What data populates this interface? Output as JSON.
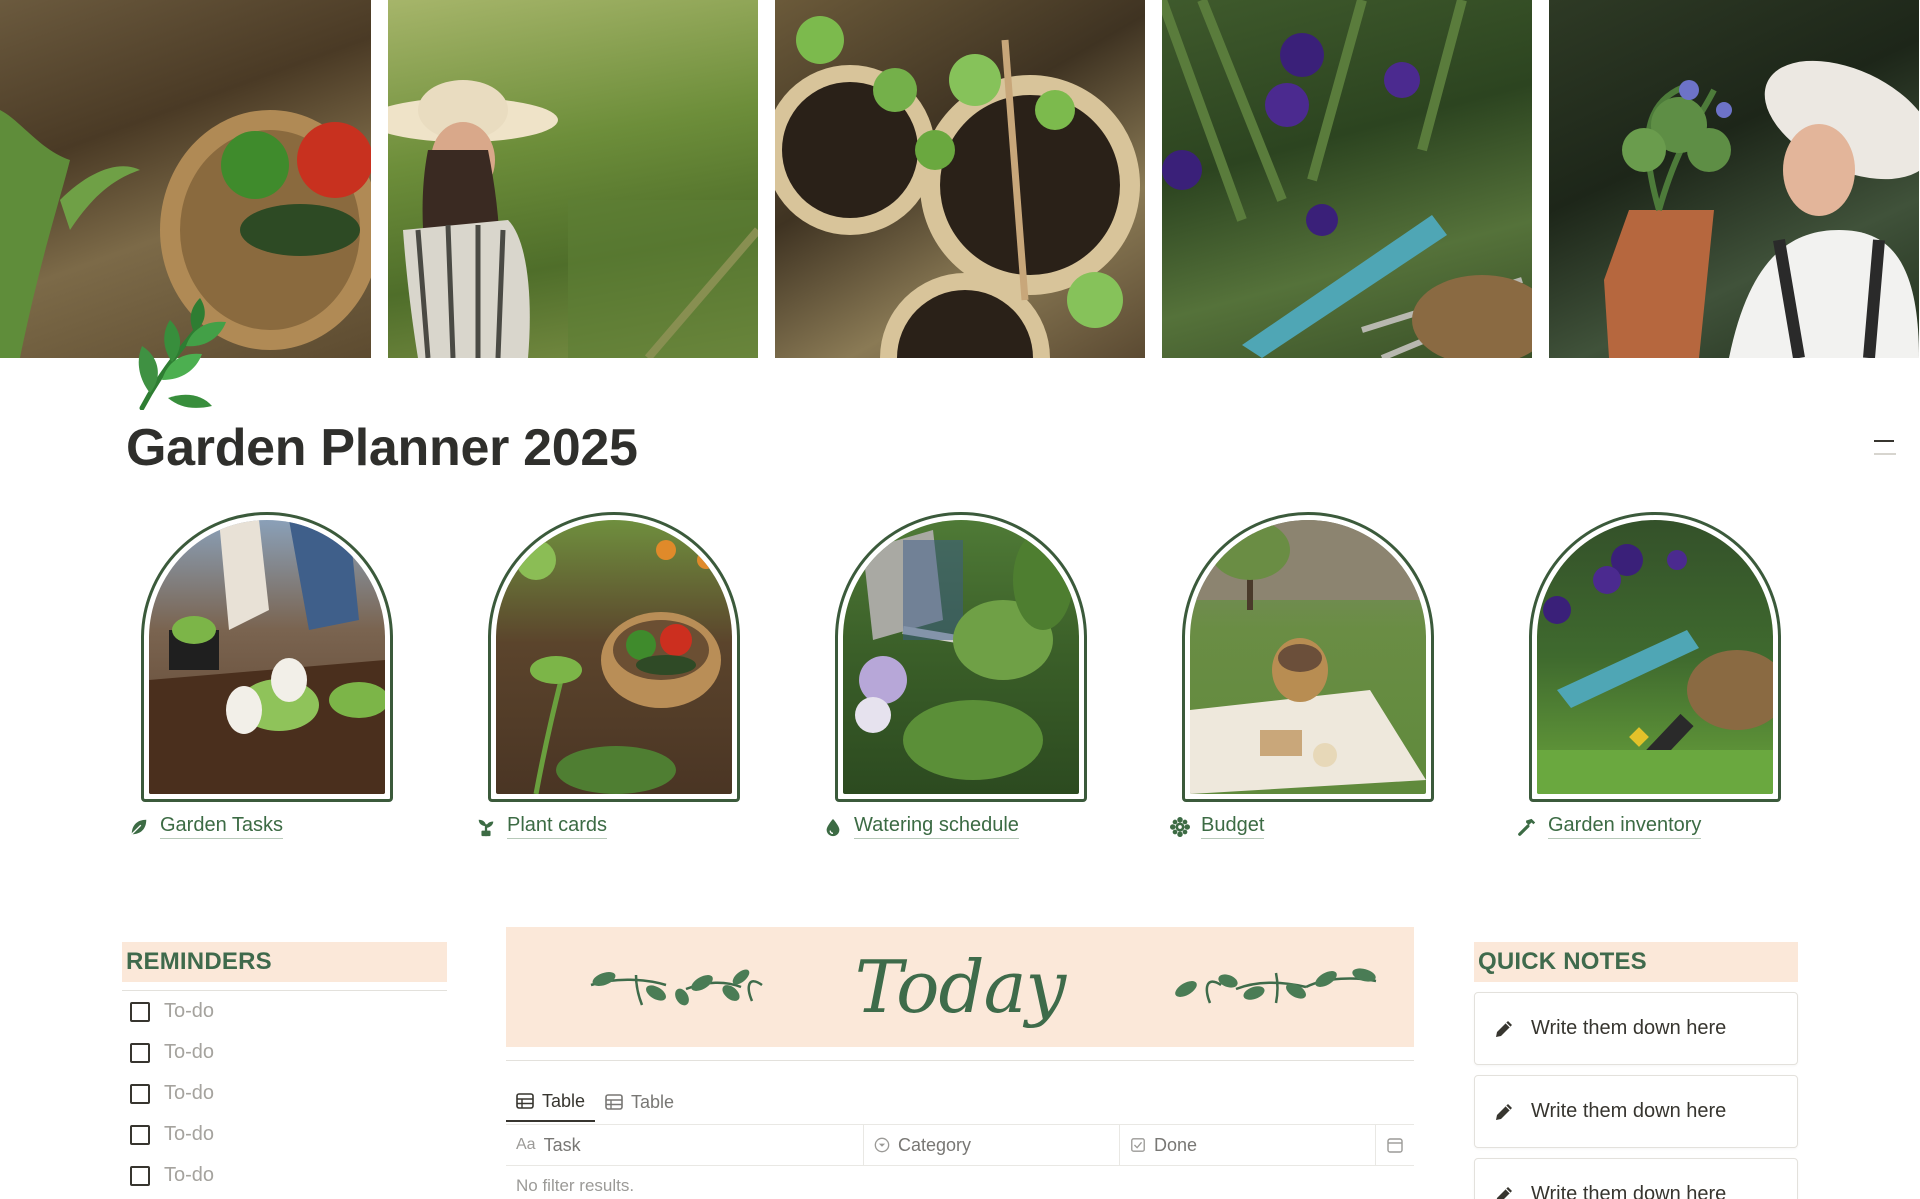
{
  "cover": {
    "photos": [
      "garden-basket-photo",
      "woman-in-garden-photo",
      "seedling-pots-photo",
      "pansies-trowel-photo",
      "woman-holding-plant-photo"
    ]
  },
  "page": {
    "icon": "leaf-sprig-icon",
    "title": "Garden Planner 2025"
  },
  "gallery": [
    {
      "label": "Garden Tasks",
      "icon": "leaf-icon",
      "image": "planting-seedlings-photo"
    },
    {
      "label": "Plant cards",
      "icon": "sprout-icon",
      "image": "vegetable-basket-photo"
    },
    {
      "label": "Watering schedule",
      "icon": "water-drop-icon",
      "image": "watering-can-photo"
    },
    {
      "label": "Budget",
      "icon": "gear-flower-icon",
      "image": "picnic-lawn-photo"
    },
    {
      "label": "Garden inventory",
      "icon": "hammer-icon",
      "image": "trowel-pansies-photo"
    }
  ],
  "reminders": {
    "heading": "REMINDERS",
    "items": [
      {
        "label": "To-do",
        "checked": false
      },
      {
        "label": "To-do",
        "checked": false
      },
      {
        "label": "To-do",
        "checked": false
      },
      {
        "label": "To-do",
        "checked": false
      },
      {
        "label": "To-do",
        "checked": false
      }
    ]
  },
  "today": {
    "banner_text": "Today",
    "tabs": [
      {
        "label": "Table",
        "active": true
      },
      {
        "label": "Table",
        "active": false
      }
    ],
    "columns": [
      {
        "label": "Task",
        "type_icon": "Aa"
      },
      {
        "label": "Category",
        "type_icon": "select-icon"
      },
      {
        "label": "Done",
        "type_icon": "checkbox-icon"
      }
    ],
    "empty_text": "No filter results."
  },
  "quick_notes": {
    "heading": "QUICK NOTES",
    "items": [
      {
        "label": "Write them down here"
      },
      {
        "label": "Write them down here"
      },
      {
        "label": "Write them down here"
      }
    ]
  },
  "colors": {
    "accent_green": "#3c6b44",
    "banner_peach": "#fbe8d9",
    "arch_border": "#3b5a3b",
    "text": "#37352f"
  }
}
